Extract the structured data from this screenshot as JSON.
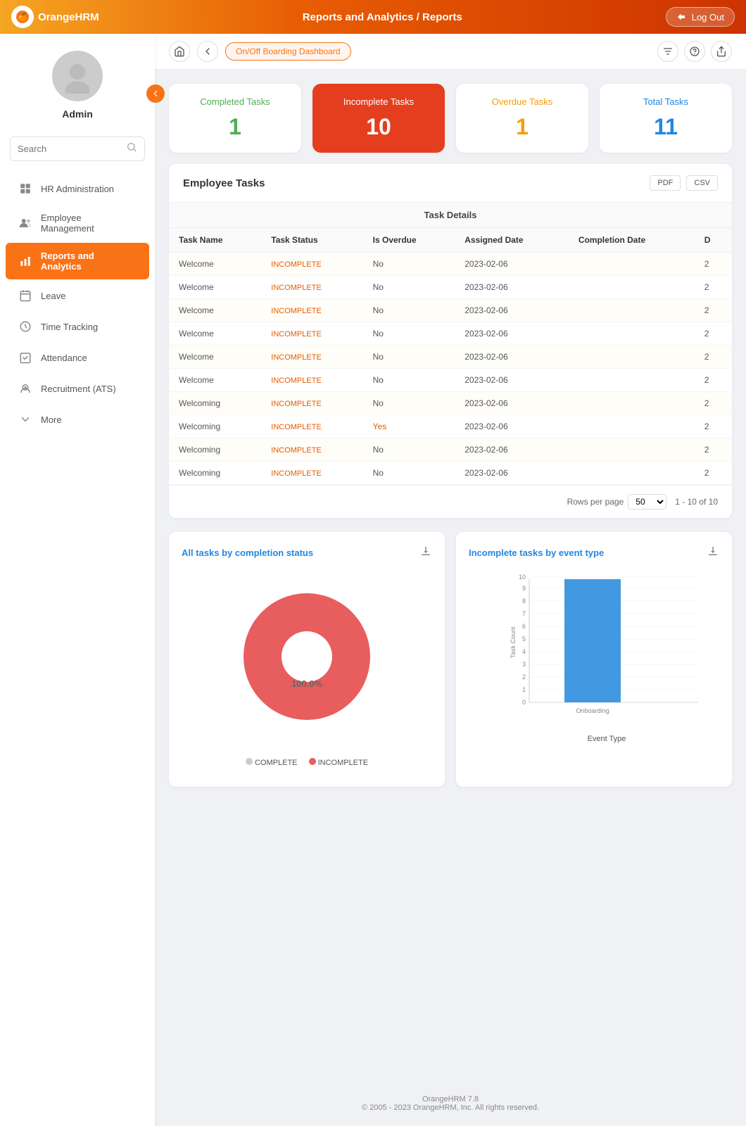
{
  "app": {
    "name": "OrangeHRM",
    "logo_text": "🍊",
    "title": "Reports and Analytics / Reports",
    "logout_label": "Log Out",
    "version": "OrangeHRM 7.8",
    "copyright": "© 2005 - 2023 OrangeHRM, Inc. All rights reserved."
  },
  "breadcrumb": {
    "dashboard_tab": "On/Off Boarding Dashboard"
  },
  "user": {
    "name": "Admin"
  },
  "search": {
    "placeholder": "Search"
  },
  "sidebar": {
    "items": [
      {
        "id": "hr-admin",
        "label": "HR Administration",
        "icon": "hr-icon"
      },
      {
        "id": "employee-mgmt",
        "label": "Employee Management",
        "icon": "employees-icon"
      },
      {
        "id": "reports-analytics",
        "label": "Reports and Analytics",
        "icon": "reports-icon",
        "active": true
      },
      {
        "id": "leave",
        "label": "Leave",
        "icon": "leave-icon"
      },
      {
        "id": "time-tracking",
        "label": "Time Tracking",
        "icon": "time-icon"
      },
      {
        "id": "attendance",
        "label": "Attendance",
        "icon": "attendance-icon"
      },
      {
        "id": "recruitment",
        "label": "Recruitment (ATS)",
        "icon": "recruitment-icon"
      },
      {
        "id": "more",
        "label": "More",
        "icon": "more-icon"
      }
    ]
  },
  "stats": {
    "completed": {
      "label": "Completed Tasks",
      "value": "1",
      "color": "green"
    },
    "incomplete": {
      "label": "Incomplete Tasks",
      "value": "10",
      "highlighted": true
    },
    "overdue": {
      "label": "Overdue Tasks",
      "value": "1",
      "color": "orange"
    },
    "total": {
      "label": "Total Tasks",
      "value": "11",
      "color": "blue"
    }
  },
  "employee_tasks": {
    "title": "Employee Tasks",
    "export_pdf": "PDF",
    "export_csv": "CSV",
    "table_section_label": "Task Details",
    "columns": [
      "Task Name",
      "Task Status",
      "Is Overdue",
      "Assigned Date",
      "Completion Date",
      "D"
    ],
    "rows": [
      {
        "task_name": "Welcome",
        "status": "INCOMPLETE",
        "overdue": "No",
        "assigned": "2023-02-06",
        "completion": "",
        "d": "2"
      },
      {
        "task_name": "Welcome",
        "status": "INCOMPLETE",
        "overdue": "No",
        "assigned": "2023-02-06",
        "completion": "",
        "d": "2"
      },
      {
        "task_name": "Welcome",
        "status": "INCOMPLETE",
        "overdue": "No",
        "assigned": "2023-02-06",
        "completion": "",
        "d": "2"
      },
      {
        "task_name": "Welcome",
        "status": "INCOMPLETE",
        "overdue": "No",
        "assigned": "2023-02-06",
        "completion": "",
        "d": "2"
      },
      {
        "task_name": "Welcome",
        "status": "INCOMPLETE",
        "overdue": "No",
        "assigned": "2023-02-06",
        "completion": "",
        "d": "2"
      },
      {
        "task_name": "Welcome",
        "status": "INCOMPLETE",
        "overdue": "No",
        "assigned": "2023-02-06",
        "completion": "",
        "d": "2"
      },
      {
        "task_name": "Welcoming",
        "status": "INCOMPLETE",
        "overdue": "No",
        "assigned": "2023-02-06",
        "completion": "",
        "d": "2"
      },
      {
        "task_name": "Welcoming",
        "status": "INCOMPLETE",
        "overdue": "Yes",
        "assigned": "2023-02-06",
        "completion": "",
        "d": "2"
      },
      {
        "task_name": "Welcoming",
        "status": "INCOMPLETE",
        "overdue": "No",
        "assigned": "2023-02-06",
        "completion": "",
        "d": "2"
      },
      {
        "task_name": "Welcoming",
        "status": "INCOMPLETE",
        "overdue": "No",
        "assigned": "2023-02-06",
        "completion": "",
        "d": "2"
      }
    ],
    "rows_per_page": "50",
    "pagination": "1 - 10 of 10"
  },
  "chart_pie": {
    "title": "All tasks by completion status",
    "legend_complete": "COMPLETE",
    "legend_incomplete": "INCOMPLETE",
    "incomplete_pct": "100.0%",
    "colors": {
      "complete": "#ccc",
      "incomplete": "#e85d5d"
    }
  },
  "chart_bar": {
    "title": "Incomplete tasks by event type",
    "x_label": "Event Type",
    "y_label": "Task Count",
    "y_max": 10,
    "bars": [
      {
        "label": "Onboarding",
        "value": 10,
        "color": "#4299e1"
      }
    ]
  }
}
